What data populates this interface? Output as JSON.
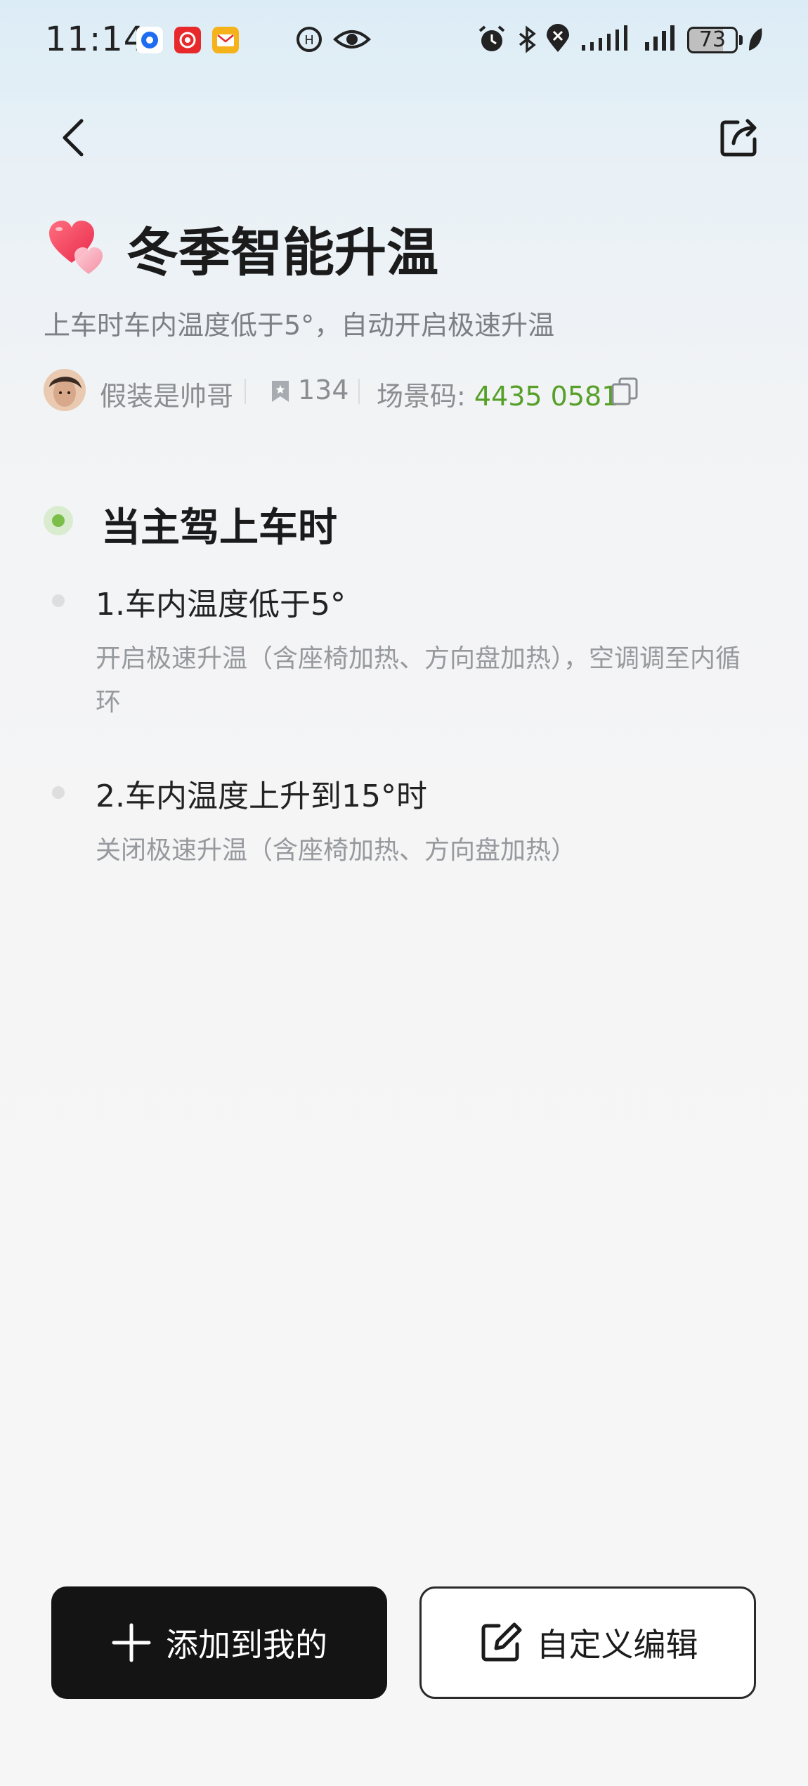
{
  "status_bar": {
    "time": "11:14",
    "battery": "73",
    "battery_level_percent": 73
  },
  "nav": {
    "back_icon": "chevron-left-icon",
    "share_icon": "share-icon"
  },
  "scene": {
    "icon": "hearts-icon",
    "title": "冬季智能升温",
    "subtitle": "上车时车内温度低于5°，自动开启极速升温",
    "author": "假装是帅哥",
    "bookmark_count": "134",
    "code_label": "场景码: ",
    "code_value": "4435 0581"
  },
  "trigger": {
    "title": "当主驾上车时",
    "steps": [
      {
        "title": "1.车内温度低于5°",
        "desc": "开启极速升温（含座椅加热、方向盘加热），空调调至内循环"
      },
      {
        "title": "2.车内温度上升到15°时",
        "desc": "关闭极速升温（含座椅加热、方向盘加热）"
      }
    ]
  },
  "actions": {
    "add_label": "添加到我的",
    "edit_label": "自定义编辑"
  },
  "colors": {
    "accent_green": "#56a028",
    "primary_button": "#141414"
  }
}
